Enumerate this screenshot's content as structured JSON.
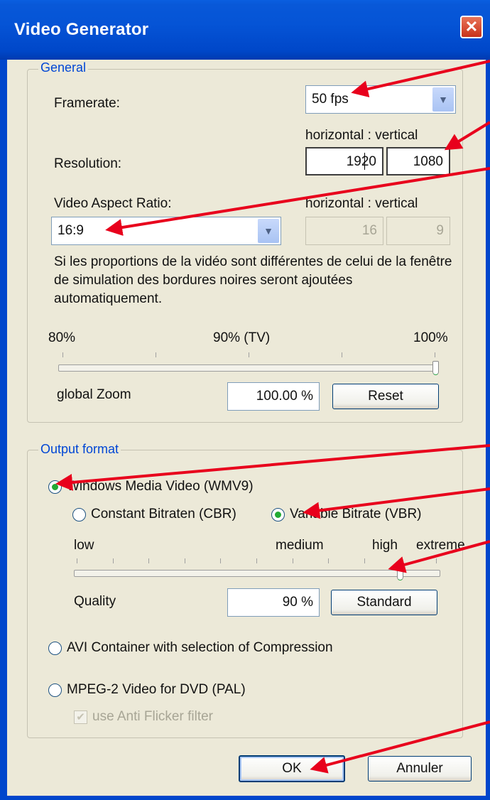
{
  "window": {
    "title": "Video Generator",
    "close_icon": "close-icon"
  },
  "general": {
    "legend": "General",
    "framerate_label": "Framerate:",
    "framerate_value": "50 fps",
    "hv_header": "horizontal : vertical",
    "resolution_label": "Resolution:",
    "resolution_h": "1920",
    "resolution_v": "1080",
    "aspect_label": "Video Aspect Ratio:",
    "aspect_value": "16:9",
    "aspect_hv_header": "horizontal : vertical",
    "aspect_h": "16",
    "aspect_v": "9",
    "info_text": "Si les proportions de la vidéo sont différentes de celui de la fenêtre de simulation des bordures noires seront ajoutées automatiquement.",
    "zoom_min": "80%",
    "zoom_mid": "90% (TV)",
    "zoom_max": "100%",
    "zoom_label": "global Zoom",
    "zoom_value": "100.00 %",
    "zoom_level_percent": 100,
    "reset_label": "Reset"
  },
  "output": {
    "legend": "Output format",
    "wmv_label": "Windows Media Video (WMV9)",
    "wmv_selected": true,
    "cbr_label": "Constant Bitraten (CBR)",
    "vbr_label": "Variable Bitrate (VBR)",
    "vbr_selected": true,
    "q_low": "low",
    "q_medium": "medium",
    "q_high": "high",
    "q_extreme": "extreme",
    "quality_label": "Quality",
    "quality_value": "90 %",
    "quality_percent": 90,
    "standard_label": "Standard",
    "avi_label": "AVI Container with selection of Compression",
    "mpeg_label": "MPEG-2 Video for DVD (PAL)",
    "antiflicker_label": "use Anti Flicker filter",
    "antiflicker_checked": true
  },
  "buttons": {
    "ok_label": "OK",
    "cancel_label": "Annuler"
  },
  "colors": {
    "annotation_arrow": "#e8001c",
    "titlebar": "#0554d6",
    "dialog_bg": "#ece9d8"
  }
}
